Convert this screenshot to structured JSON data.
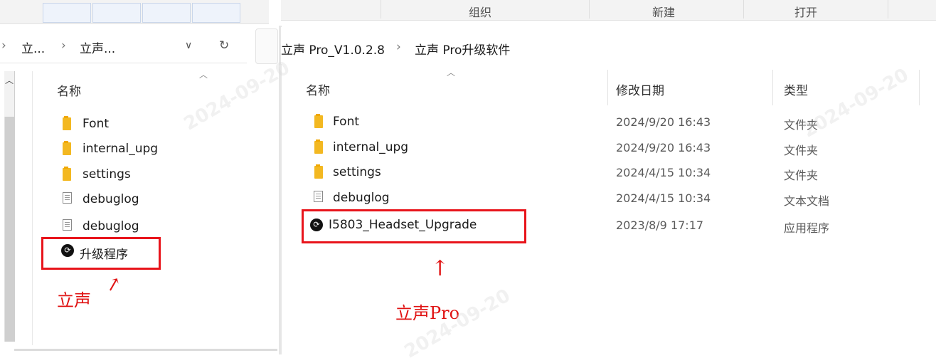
{
  "left_window": {
    "address": {
      "crumb1": "立...",
      "crumb2": "立声...",
      "sep": "›",
      "dropdown": "∨",
      "refresh": "↻"
    },
    "header_name": "名称",
    "items": [
      {
        "name": "Font",
        "type": "folder"
      },
      {
        "name": "internal_upg",
        "type": "folder"
      },
      {
        "name": "settings",
        "type": "folder"
      },
      {
        "name": "debuglog",
        "type": "text"
      },
      {
        "name": "debuglog",
        "type": "text"
      },
      {
        "name": "升级程序",
        "type": "app"
      }
    ],
    "annotation": "立声"
  },
  "right_window": {
    "menu": [
      "组织",
      "新建",
      "打开"
    ],
    "address": {
      "part1": "立声 Pro_V1.0.2.8",
      "sep": "›",
      "part2": "立声 Pro升级软件"
    },
    "headers": {
      "name": "名称",
      "modified": "修改日期",
      "type": "类型"
    },
    "items": [
      {
        "name": "Font",
        "date": "2024/9/20 16:43",
        "type": "文件夹",
        "kind": "folder"
      },
      {
        "name": "internal_upg",
        "date": "2024/9/20 16:43",
        "type": "文件夹",
        "kind": "folder"
      },
      {
        "name": "settings",
        "date": "2024/4/15 10:34",
        "type": "文件夹",
        "kind": "folder"
      },
      {
        "name": "debuglog",
        "date": "2024/4/15 10:34",
        "type": "文本文档",
        "kind": "text"
      },
      {
        "name": "I5803_Headset_Upgrade",
        "date": "2023/8/9 17:17",
        "type": "应用程序",
        "kind": "app"
      }
    ],
    "annotation": "立声Pro"
  },
  "watermark_text": "2024-09-20",
  "colors": {
    "highlight": "#e8141b",
    "folder": "#f3b821"
  }
}
